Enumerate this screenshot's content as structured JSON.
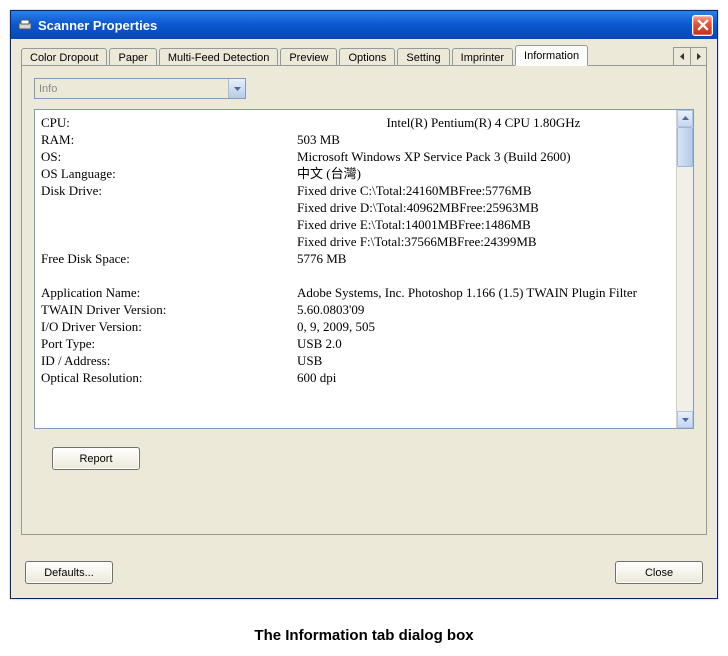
{
  "window": {
    "title": "Scanner Properties"
  },
  "tabs": [
    {
      "label": "Color Dropout"
    },
    {
      "label": "Paper"
    },
    {
      "label": "Multi-Feed Detection"
    },
    {
      "label": "Preview"
    },
    {
      "label": "Options"
    },
    {
      "label": "Setting"
    },
    {
      "label": "Imprinter"
    },
    {
      "label": "Information"
    }
  ],
  "dropdown": {
    "selected": "Info"
  },
  "info": {
    "cpu_label": "CPU:",
    "cpu_value": "Intel(R) Pentium(R) 4 CPU 1.80GHz",
    "ram_label": "RAM:",
    "ram_value": "503 MB",
    "os_label": "OS:",
    "os_value": "Microsoft Windows XP Service Pack 3 (Build 2600)",
    "oslang_label": "OS Language:",
    "oslang_value": "中文 (台灣)",
    "disk_label": "Disk Drive:",
    "disk_c": "Fixed drive C:\\Total:24160MBFree:5776MB",
    "disk_d": "Fixed drive D:\\Total:40962MBFree:25963MB",
    "disk_e": "Fixed drive E:\\Total:14001MBFree:1486MB",
    "disk_f": "Fixed drive F:\\Total:37566MBFree:24399MB",
    "free_label": "Free Disk Space:",
    "free_value": "5776 MB",
    "app_label": "Application Name:",
    "app_value": "Adobe Systems, Inc. Photoshop 1.166 (1.5) TWAIN Plugin Filter",
    "twain_label": "TWAIN Driver Version:",
    "twain_value": "5.60.0803'09",
    "io_label": "I/O Driver Version:",
    "io_value": "0, 9, 2009, 505",
    "port_label": "Port Type:",
    "port_value": "USB 2.0",
    "id_label": "ID / Address:",
    "id_value": "USB",
    "opt_label": "Optical Resolution:",
    "opt_value": "600 dpi"
  },
  "buttons": {
    "report": "Report",
    "defaults": "Defaults...",
    "close": "Close"
  },
  "caption": "The Information tab dialog box"
}
